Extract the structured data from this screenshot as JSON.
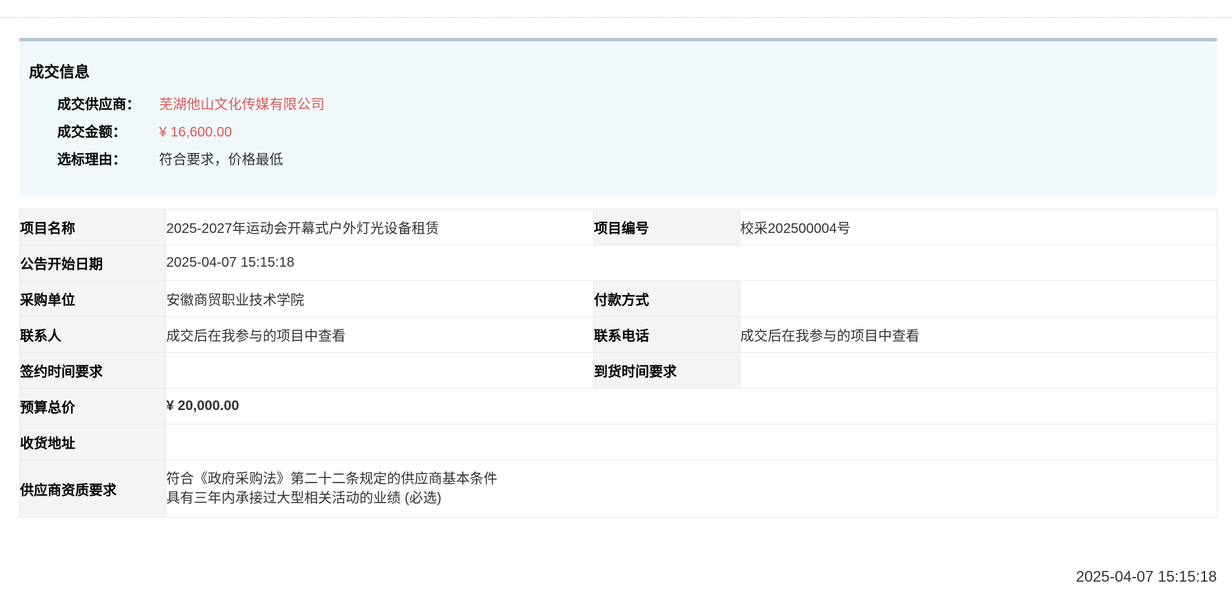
{
  "colors": {
    "panel_accent_bar": "#b2c7d3",
    "panel_background": "#f1f8fb",
    "red_value": "#dd5a57",
    "red_bold_value": "#d8433e",
    "label_cell_background": "#f4f4f4",
    "table_border": "#e9e9e9"
  },
  "panel": {
    "title": "成交信息",
    "rows": [
      {
        "label": "成交供应商：",
        "value": "芜湖他山文化传媒有限公司"
      },
      {
        "label": "成交金额：",
        "value": "¥ 16,600.00"
      },
      {
        "label": "选标理由：",
        "value": "符合要求，价格最低"
      }
    ]
  },
  "table": {
    "rows": [
      {
        "label1": "项目名称",
        "value1": "2025-2027年运动会开幕式户外灯光设备租赁",
        "label2": "项目编号",
        "value2": "校采202500004号"
      },
      {
        "label1": "公告开始日期",
        "value1": "2025-04-07 15:15:18"
      },
      {
        "label1": "采购单位",
        "value1": "安徽商贸职业技术学院",
        "label2": "付款方式",
        "value2": ""
      },
      {
        "label1": "联系人",
        "value1": "成交后在我参与的项目中查看",
        "label2": "联系电话",
        "value2": "成交后在我参与的项目中查看"
      },
      {
        "label1": "签约时间要求",
        "value1": "",
        "label2": "到货时间要求",
        "value2": ""
      },
      {
        "label1": "预算总价",
        "value1": "¥ 20,000.00"
      },
      {
        "label1": "收货地址",
        "value1": ""
      },
      {
        "label1": "供应商资质要求",
        "lines": [
          "符合《政府采购法》第二十二条规定的供应商基本条件",
          "具有三年内承接过大型相关活动的业绩 (必选)"
        ]
      }
    ]
  },
  "footer": {
    "timestamp": "2025-04-07 15:15:18"
  }
}
